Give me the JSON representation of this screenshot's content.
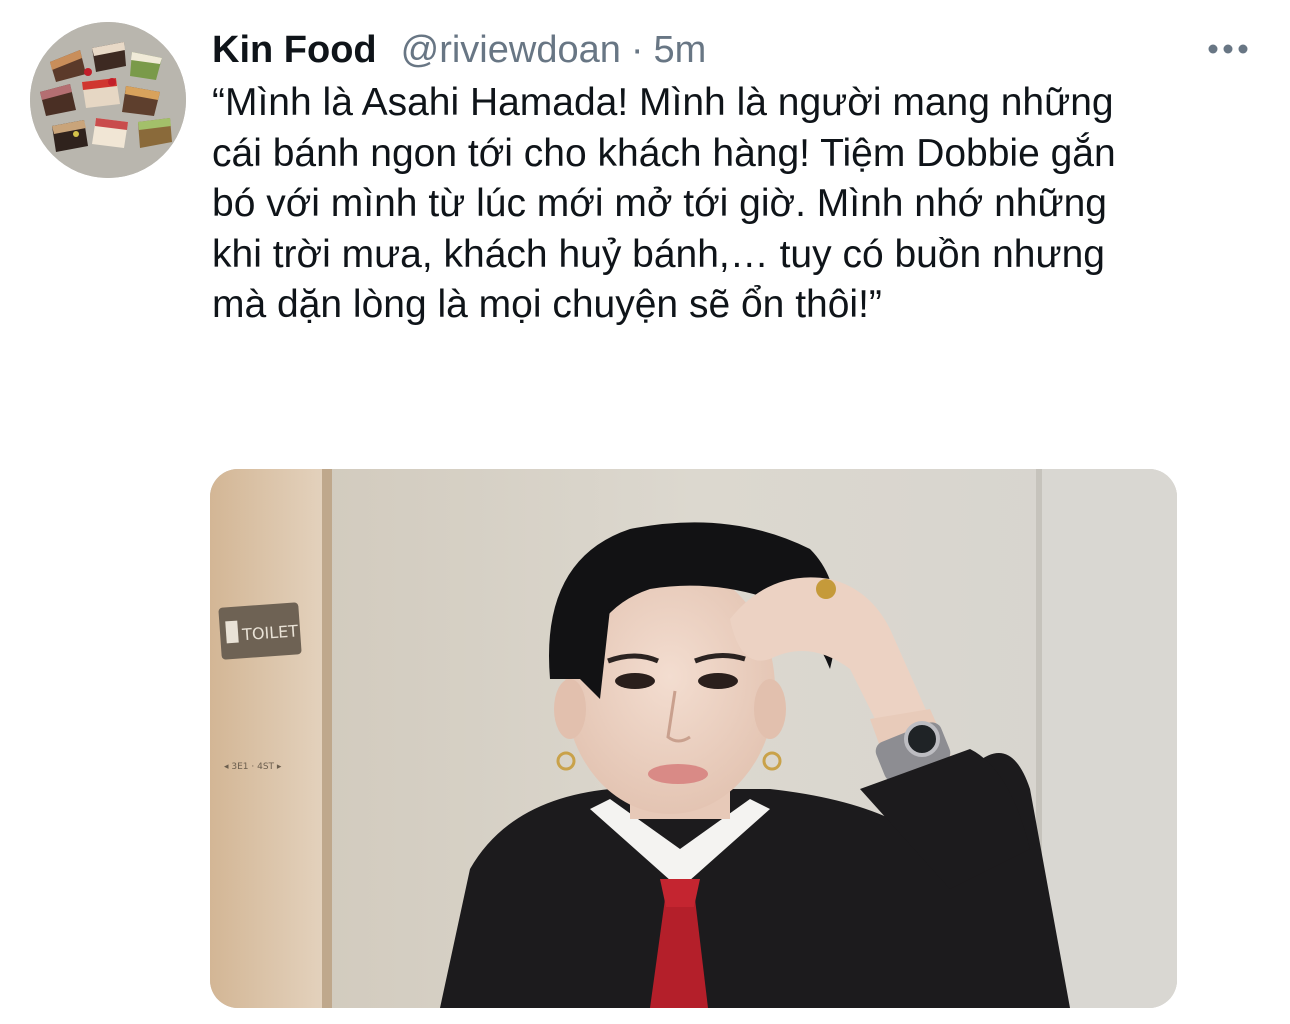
{
  "author": {
    "display_name": "Kin Food",
    "handle": "@riviewdoan",
    "separator": "·",
    "timestamp": "5m",
    "avatar_icon": "cake-avatar"
  },
  "tweet": {
    "text": "“Mình là Asahi Hamada! Mình là người mang những\ncái bánh ngon tới cho khách hàng! Tiệm Dobbie gắn\nbó với mình từ lúc mới mở tới giờ. Mình nhớ những\nkhi trời mưa, khách huỷ bánh,… tuy có buồn nhưng\nmà dặn lòng là mọi chuyện sẽ ổn thôi!”"
  },
  "media": {
    "sign_text": "TOILET",
    "small_sign_text": "◂ 3E1 · 4ST ▸"
  },
  "actions": {
    "more_icon": "more-horizontal-icon"
  },
  "colors": {
    "text_primary": "#0f1419",
    "text_secondary": "#687684",
    "background": "#ffffff"
  }
}
